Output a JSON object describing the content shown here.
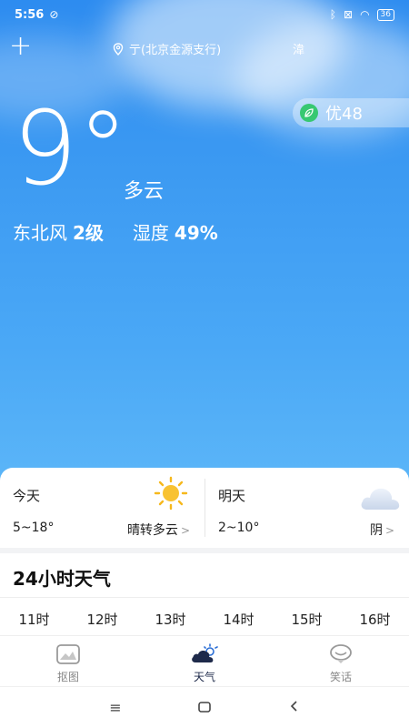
{
  "status": {
    "time": "5:56",
    "battery": "36"
  },
  "topbar": {
    "location": "亍(北京金源支行)",
    "right_text": "湋"
  },
  "aqi": {
    "text": "优48"
  },
  "current": {
    "temperature": "9°",
    "description": "多云",
    "wind_label": "东北风",
    "wind_value": "2级",
    "humidity_label": "湿度",
    "humidity_value": "49%"
  },
  "forecast": {
    "today": {
      "label": "今天",
      "range": "5~18°",
      "condition": "晴转多云",
      "icon": "sun-icon"
    },
    "tomorrow": {
      "label": "明天",
      "range": "2~10°",
      "condition": "阴",
      "icon": "cloud-icon"
    }
  },
  "hourly": {
    "title": "24小时天气",
    "hours": [
      "11时",
      "12时",
      "13时",
      "14时",
      "15时",
      "16时"
    ]
  },
  "tabs": [
    {
      "label": "抠图",
      "icon": "image-icon"
    },
    {
      "label": "天气",
      "icon": "weather-icon"
    },
    {
      "label": "笑话",
      "icon": "chat-icon"
    }
  ],
  "colors": {
    "sky_top": "#2d8cf0",
    "sky_bottom": "#5cb6f8",
    "aqi_green": "#37c871",
    "sun": "#f6b81c"
  }
}
